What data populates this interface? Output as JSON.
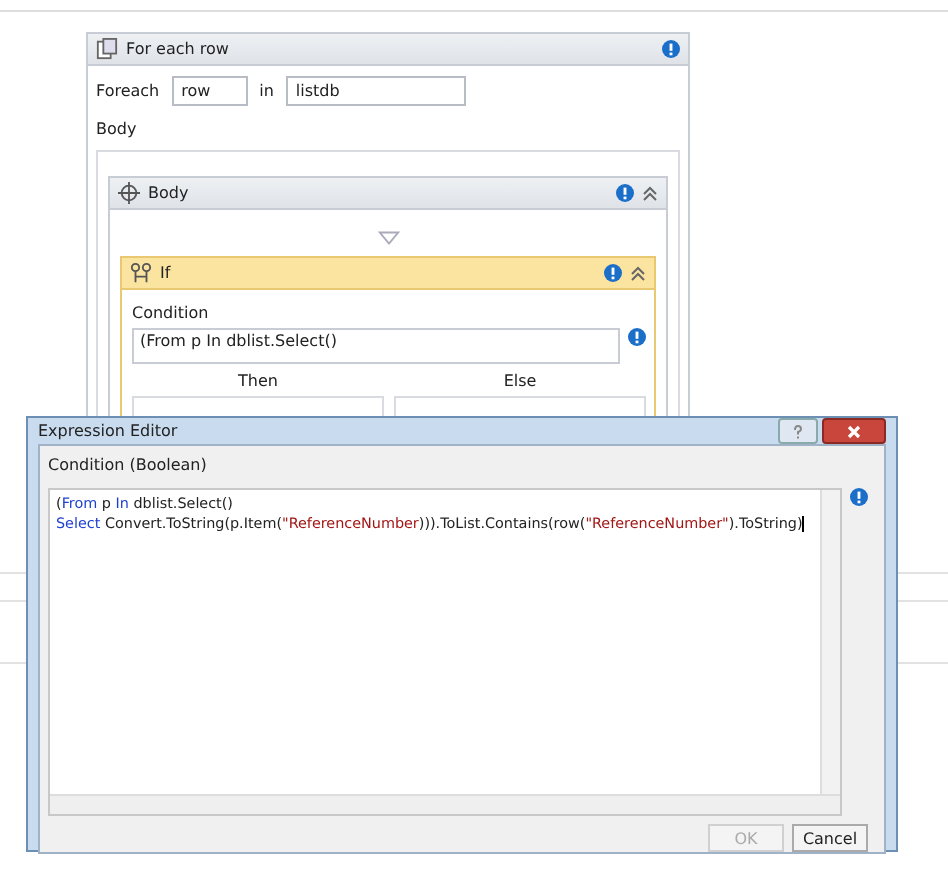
{
  "foreach_activity": {
    "title": "For each row",
    "foreach_label": "Foreach",
    "item_variable": "row",
    "in_label": "in",
    "collection": "listdb",
    "body_label": "Body",
    "body_sequence": {
      "title": "Body",
      "if_activity": {
        "title": "If",
        "condition_label": "Condition",
        "condition_preview": "(From p In dblist.Select()",
        "then_label": "Then",
        "else_label": "Else"
      }
    }
  },
  "expression_editor": {
    "title": "Expression Editor",
    "label": "Condition (Boolean)",
    "lines": [
      [
        {
          "kind": "plain",
          "text": "("
        },
        {
          "kind": "keyword",
          "text": "From"
        },
        {
          "kind": "plain",
          "text": " p "
        },
        {
          "kind": "keyword",
          "text": "In"
        },
        {
          "kind": "plain",
          "text": " dblist.Select()"
        }
      ],
      [
        {
          "kind": "keyword",
          "text": "Select"
        },
        {
          "kind": "plain",
          "text": " Convert.ToString(p.Item("
        },
        {
          "kind": "string",
          "text": "\"ReferenceNumber"
        },
        {
          "kind": "plain",
          "text": "))).ToList.Contains(row("
        },
        {
          "kind": "string",
          "text": "\"ReferenceNumber\""
        },
        {
          "kind": "plain",
          "text": ").ToString)"
        }
      ]
    ],
    "buttons": [
      {
        "label": "OK",
        "disabled": true
      },
      {
        "label": "Cancel",
        "disabled": false
      }
    ]
  }
}
